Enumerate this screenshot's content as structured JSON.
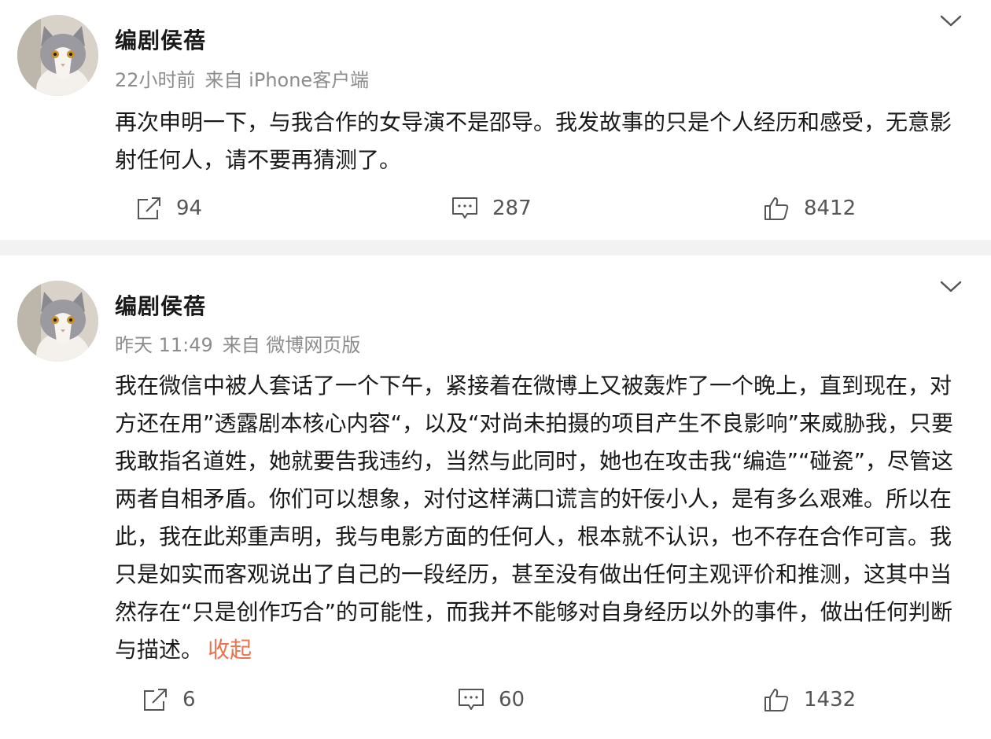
{
  "posts": [
    {
      "author": "编剧侯蓓",
      "time": "22小时前",
      "source": "来自 iPhone客户端",
      "text": "再次申明一下，与我合作的女导演不是邵导。我发故事的只是个人经历和感受，无意影射任何人，请不要再猜测了。",
      "reposts": "94",
      "comments": "287",
      "likes": "8412"
    },
    {
      "author": "编剧侯蓓",
      "time": "昨天 11:49",
      "source": "来自 微博网页版",
      "text": "我在微信中被人套话了一个下午，紧接着在微博上又被轰炸了一个晚上，直到现在，对方还在用”透露剧本核心内容“，以及“对尚未拍摄的项目产生不良影响”来威胁我，只要我敢指名道姓，她就要告我违约，当然与此同时，她也在攻击我“编造”“碰瓷”，尽管这两者自相矛盾。你们可以想象，对付这样满口谎言的奸佞小人，是有多么艰难。所以在此，我在此郑重声明，我与电影方面的任何人，根本就不认识，也不存在合作可言。我只是如实而客观说出了自己的一段经历，甚至没有做出任何主观评价和推测，这其中当然存在“只是创作巧合”的可能性，而我并不能够对自身经历以外的事件，做出任何判断与描述。",
      "collapse_label": "收起",
      "reposts": "6",
      "comments": "60",
      "likes": "1432"
    }
  ],
  "icons": {
    "more": "chevron-down-icon",
    "repost": "repost-icon",
    "comment": "comment-icon",
    "like": "thumbs-up-icon"
  },
  "colors": {
    "accent": "#eb7350",
    "meta": "#8c8c8c",
    "separator": "#f2f2f2"
  }
}
